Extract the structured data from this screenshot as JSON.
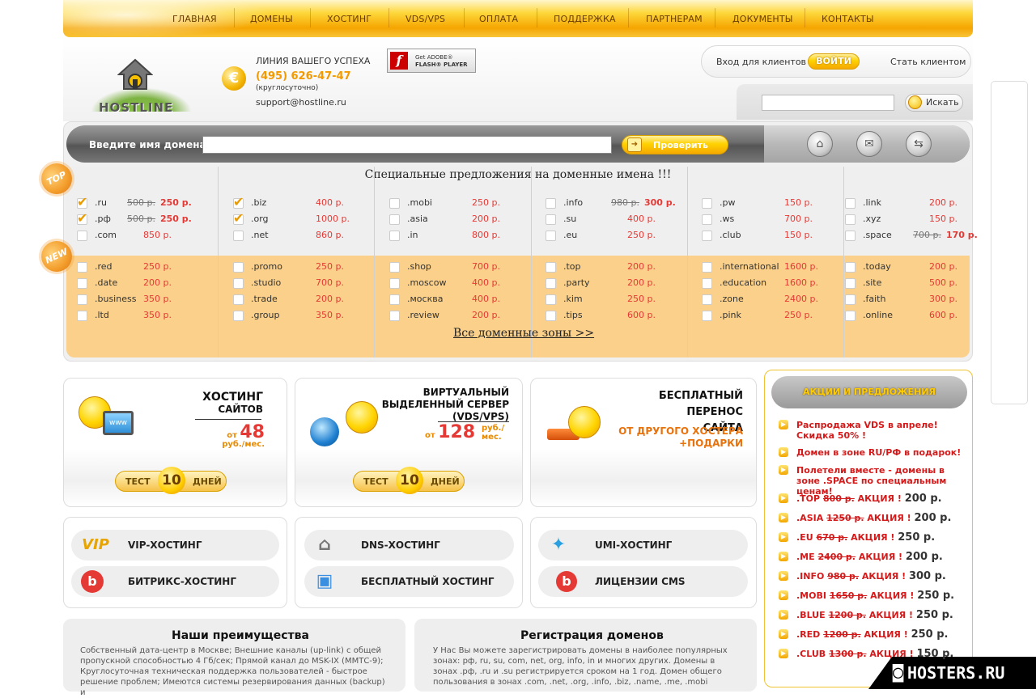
{
  "nav": [
    "ГЛАВНАЯ",
    "ДОМЕНЫ",
    "ХОСТИНГ",
    "VDS/VPS",
    "ОПЛАТА",
    "ПОДДЕРЖКА",
    "ПАРТНЕРАМ",
    "ДОКУМЕНТЫ",
    "КОНТАКТЫ"
  ],
  "header": {
    "logo_text": "HOSTLINE",
    "tagline": "ЛИНИЯ ВАШЕГО УСПЕХА",
    "phone": "(495) 626-47-47",
    "hours": "(круглосуточно)",
    "email": "support@hostline.ru",
    "flash_line1": "Get ADOBE®",
    "flash_line2": "FLASH® PLAYER"
  },
  "login": {
    "client_login": "Вход для клиентов",
    "enter": "ВОЙТИ",
    "become": "Стать клиентом"
  },
  "search": {
    "button": "Искать",
    "value": ""
  },
  "domain_search": {
    "label": "Введите имя домена:",
    "button": "Проверить",
    "value": ""
  },
  "badges": {
    "top": "TOP",
    "new": "NEW"
  },
  "offers_title": "Специальные предложения на доменные имена !!!",
  "all_zones": "Все доменные зоны >>",
  "top_columns": [
    [
      {
        "n": ".ru",
        "old": "500 р.",
        "p": "250 р.",
        "c": true
      },
      {
        "n": ".рф",
        "old": "500 р.",
        "p": "250 р.",
        "c": true
      },
      {
        "n": ".com",
        "p": "850 р."
      }
    ],
    [
      {
        "n": ".biz",
        "p": "400 р.",
        "c": true
      },
      {
        "n": ".org",
        "p": "1000 р.",
        "c": true
      },
      {
        "n": ".net",
        "p": "860 р."
      }
    ],
    [
      {
        "n": ".mobi",
        "p": "250 р."
      },
      {
        "n": ".asia",
        "p": "200 р."
      },
      {
        "n": ".in",
        "p": "800 р."
      }
    ],
    [
      {
        "n": ".info",
        "old": "980 р.",
        "p": "300 р."
      },
      {
        "n": ".su",
        "p": "400 р."
      },
      {
        "n": ".eu",
        "p": "250 р."
      }
    ],
    [
      {
        "n": ".pw",
        "p": "150 р."
      },
      {
        "n": ".ws",
        "p": "700 р."
      },
      {
        "n": ".club",
        "p": "150 р."
      }
    ],
    [
      {
        "n": ".link",
        "p": "200 р."
      },
      {
        "n": ".xyz",
        "p": "150 р."
      },
      {
        "n": ".space",
        "old": "700 р.",
        "p": "170 р."
      }
    ]
  ],
  "new_columns": [
    [
      {
        "n": ".red",
        "p": "250 р."
      },
      {
        "n": ".date",
        "p": "200 р."
      },
      {
        "n": ".business",
        "p": "350 р."
      },
      {
        "n": ".ltd",
        "p": "350 р."
      }
    ],
    [
      {
        "n": ".promo",
        "p": "250 р."
      },
      {
        "n": ".studio",
        "p": "700 р."
      },
      {
        "n": ".trade",
        "p": "200 р."
      },
      {
        "n": ".group",
        "p": "350 р."
      }
    ],
    [
      {
        "n": ".shop",
        "p": "700 р."
      },
      {
        "n": ".moscow",
        "p": "400 р."
      },
      {
        "n": ".москва",
        "p": "400 р."
      },
      {
        "n": ".review",
        "p": "200 р."
      }
    ],
    [
      {
        "n": ".top",
        "p": "200 р."
      },
      {
        "n": ".party",
        "p": "200 р."
      },
      {
        "n": ".kim",
        "p": "250 р."
      },
      {
        "n": ".tips",
        "p": "600 р."
      }
    ],
    [
      {
        "n": ".international",
        "p": "1600 р."
      },
      {
        "n": ".education",
        "p": "1600 р."
      },
      {
        "n": ".zone",
        "p": "2400 р."
      },
      {
        "n": ".pink",
        "p": "250 р."
      }
    ],
    [
      {
        "n": ".today",
        "p": "200 р."
      },
      {
        "n": ".site",
        "p": "500 р."
      },
      {
        "n": ".faith",
        "p": "300 р."
      },
      {
        "n": ".online",
        "p": "600 р."
      }
    ]
  ],
  "cards": {
    "hosting": {
      "t1": "ХОСТИНГ",
      "t2": "САЙТОВ",
      "from": "от",
      "price": "48",
      "unit1": "руб./",
      "unit2": "мес.",
      "test": "ТЕСТ",
      "days_num": "10",
      "days": "ДНЕЙ",
      "screen": "www"
    },
    "vps": {
      "t1": "ВИРТУАЛЬНЫЙ",
      "t2": "ВЫДЕЛЕННЫЙ СЕРВЕР",
      "t3": "(VDS/VPS)",
      "from": "от",
      "price": "128",
      "unit1": "руб./",
      "unit2": "мес.",
      "test": "ТЕСТ",
      "days_num": "10",
      "days": "ДНЕЙ"
    },
    "transfer": {
      "t1": "БЕСПЛАТНЫЙ ПЕРЕНОС",
      "t2": "САЙТА",
      "n1": "ОТ ДРУГОГО ХОСТЕРА",
      "n2": "+ПОДАРКИ"
    }
  },
  "hosting_items": [
    {
      "icon": "VIP",
      "label": "VIP-ХОСТИНГ"
    },
    {
      "icon": "⌂",
      "label": "DNS-ХОСТИНГ"
    },
    {
      "icon": "✦",
      "label": "UMI-ХОСТИНГ"
    },
    {
      "icon": "b",
      "label": "БИТРИКС-ХОСТИНГ"
    },
    {
      "icon": "▣",
      "label": "БЕСПЛАТНЫЙ ХОСТИНГ"
    },
    {
      "icon": "b",
      "label": "ЛИЦЕНЗИИ CMS"
    }
  ],
  "advantages": {
    "title": "Наши преимущества",
    "text": "Собственный дата-центр в Москве; Внешние каналы (up-link) с общей пропускной способностью 4 Гб/сек; Прямой канал до MSK-IX (ММТС-9); Круглосуточная техническая поддержка пользователей - быстрое решение проблем; Имеются системы резервирования данных (backup) и"
  },
  "registration": {
    "title": "Регистрация доменов",
    "text": "У Нас Вы можете зарегистрировать домены в наиболее популярных зонах: рф, ru, su, com, net, org, info, in и многих других. Домены в зонах .рф, .ru и .su регистрируется сроком на 1 год. Домен общего пользования в зонах .com, .net, .org, .info, .biz, .name, .me, .mobi"
  },
  "promo": {
    "title": "АКЦИИ И ПРЕДЛОЖЕНИЯ",
    "items": [
      {
        "text": "Распродажа VDS в апреле! Скидка 50% !"
      },
      {
        "text": "Домен в зоне RU/РФ в подарок!"
      },
      {
        "text": "Полетели вместе - домены в зоне .SPACE по специальным ценам!"
      },
      {
        "zone": ".TOP",
        "old": "800 р.",
        "label": "АКЦИЯ !",
        "price": "200 р."
      },
      {
        "zone": ".ASIA",
        "old": "1250 р.",
        "label": "АКЦИЯ !",
        "price": "200 р."
      },
      {
        "zone": ".EU",
        "old": "670 р.",
        "label": "АКЦИЯ !",
        "price": "250 р."
      },
      {
        "zone": ".ME",
        "old": "2400 р.",
        "label": "АКЦИЯ !",
        "price": "200 р."
      },
      {
        "zone": ".INFO",
        "old": "980 р.",
        "label": "АКЦИЯ !",
        "price": "300 р."
      },
      {
        "zone": ".MOBI",
        "old": "1650 р.",
        "label": "АКЦИЯ !",
        "price": "250 р."
      },
      {
        "zone": ".BLUE",
        "old": "1200 р.",
        "label": "АКЦИЯ !",
        "price": "250 р."
      },
      {
        "zone": ".RED",
        "old": "1200 р.",
        "label": "АКЦИЯ !",
        "price": "250 р."
      },
      {
        "zone": ".CLUB",
        "old": "1300 р.",
        "label": "АКЦИЯ !",
        "price": "150 р."
      }
    ]
  },
  "watermark": "HOSTERS.RU",
  "colors": {
    "accent": "#f5a500",
    "price_red": "#e53935",
    "new_bg": "#fbd08a",
    "promo_red": "#d41a1a"
  }
}
